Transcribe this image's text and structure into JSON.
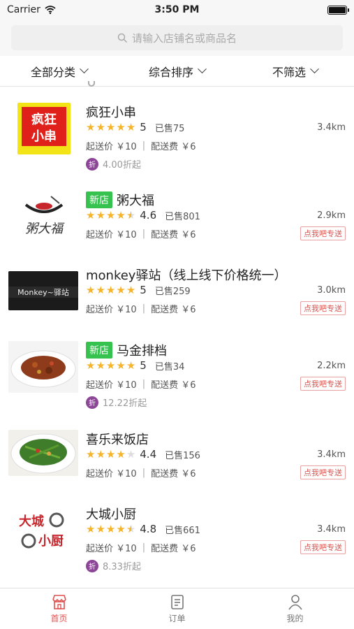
{
  "status_bar": {
    "carrier": "Carrier",
    "time": "3:50 PM"
  },
  "search": {
    "placeholder": "请输入店铺名或商品名"
  },
  "filters": [
    {
      "label": "全部分类"
    },
    {
      "label": "综合排序"
    },
    {
      "label": "不筛选"
    }
  ],
  "shops": [
    {
      "name": "疯狂小串",
      "is_new": false,
      "stars": 5,
      "score": "5",
      "sold": "已售75",
      "distance": "3.4km",
      "min_order": "起送价 ￥10",
      "delivery_fee": "配送费 ￥6",
      "deliver_tag": "",
      "promo": "4.00折起",
      "promo_badge": "折",
      "thumb_text": "疯狂小串"
    },
    {
      "name": "粥大福",
      "is_new": true,
      "new_label": "新店",
      "stars": 4.5,
      "score": "4.6",
      "sold": "已售801",
      "distance": "2.9km",
      "min_order": "起送价 ￥10",
      "delivery_fee": "配送费 ￥6",
      "deliver_tag": "点我吧专送",
      "promo": "",
      "thumb_text": "粥大福"
    },
    {
      "name": "monkey驿站（线上线下价格统一）",
      "is_new": false,
      "stars": 5,
      "score": "5",
      "sold": "已售259",
      "distance": "3.0km",
      "min_order": "起送价 ￥10",
      "delivery_fee": "配送费 ￥6",
      "deliver_tag": "点我吧专送",
      "promo": "",
      "thumb_text": "Monkey~驿站"
    },
    {
      "name": "马金排档",
      "is_new": true,
      "new_label": "新店",
      "stars": 5,
      "score": "5",
      "sold": "已售34",
      "distance": "2.2km",
      "min_order": "起送价 ￥10",
      "delivery_fee": "配送费 ￥6",
      "deliver_tag": "点我吧专送",
      "promo": "12.22折起",
      "promo_badge": "折",
      "thumb_text": ""
    },
    {
      "name": "喜乐来饭店",
      "is_new": false,
      "stars": 4,
      "score": "4.4",
      "sold": "已售156",
      "distance": "3.4km",
      "min_order": "起送价 ￥10",
      "delivery_fee": "配送费 ￥6",
      "deliver_tag": "点我吧专送",
      "promo": "",
      "thumb_text": ""
    },
    {
      "name": "大城小厨",
      "is_new": false,
      "stars": 4.5,
      "score": "4.8",
      "sold": "已售661",
      "distance": "3.4km",
      "min_order": "起送价 ￥10",
      "delivery_fee": "配送费 ￥6",
      "deliver_tag": "点我吧专送",
      "promo": "8.33折起",
      "promo_badge": "折",
      "thumb_text": "大城小厨"
    }
  ],
  "tabs": [
    {
      "label": "首页",
      "icon": "home-icon",
      "active": true
    },
    {
      "label": "订单",
      "icon": "order-icon",
      "active": false
    },
    {
      "label": "我的",
      "icon": "user-icon",
      "active": false
    }
  ],
  "colors": {
    "accent": "#e0504f",
    "new_tag": "#35c24f",
    "star": "#f6b42b",
    "promo": "#8c4597"
  }
}
